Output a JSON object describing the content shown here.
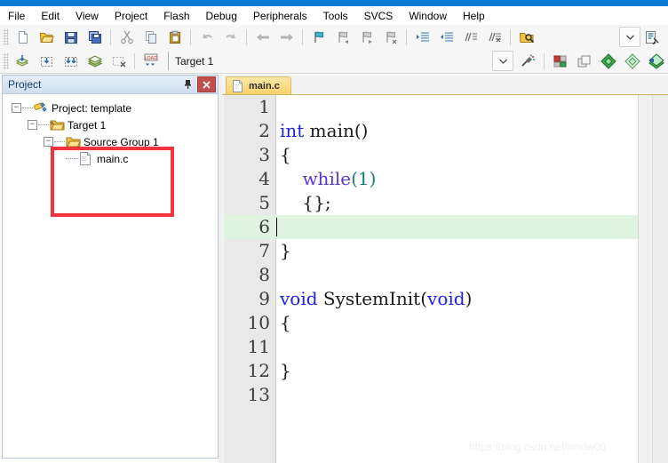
{
  "window": {
    "accent_color": "#0a7bd4"
  },
  "menubar": {
    "items": [
      {
        "label": "File"
      },
      {
        "label": "Edit"
      },
      {
        "label": "View"
      },
      {
        "label": "Project"
      },
      {
        "label": "Flash"
      },
      {
        "label": "Debug"
      },
      {
        "label": "Peripherals"
      },
      {
        "label": "Tools"
      },
      {
        "label": "SVCS"
      },
      {
        "label": "Window"
      },
      {
        "label": "Help"
      }
    ]
  },
  "toolbar1": {
    "icons": [
      "new-file-icon",
      "open-file-icon",
      "save-icon",
      "save-all-icon",
      "cut-icon",
      "copy-icon",
      "paste-icon",
      "undo-icon",
      "redo-icon",
      "navigate-back-icon",
      "navigate-forward-icon",
      "bookmark-toggle-icon",
      "bookmark-prev-icon",
      "bookmark-next-icon",
      "bookmark-clear-icon",
      "indent-icon",
      "outdent-icon",
      "comment-icon",
      "uncomment-icon",
      "find-in-files-icon"
    ],
    "right_icons": [
      "combo-arrow-icon",
      "configure-icon"
    ]
  },
  "toolbar2": {
    "icons": [
      "translate-icon",
      "build-icon",
      "rebuild-icon",
      "batch-build-icon",
      "stop-build-icon",
      "download-icon"
    ],
    "target_value": "Target 1",
    "target_placeholder": "Target 1",
    "right_icons": [
      "combo-arrow-icon",
      "target-options-icon"
    ],
    "trailing_icons": [
      "manage-components-icon",
      "pack-installer-icon",
      "manage-runtime-icon",
      "pack-manager-icon"
    ]
  },
  "project_panel": {
    "title": "Project",
    "pin_icon": "pin-icon",
    "close_icon": "close-icon",
    "tree": [
      {
        "label": "Project: template",
        "icon": "project-icon",
        "depth": 0,
        "expander": "-"
      },
      {
        "label": "Target 1",
        "icon": "target-folder-icon",
        "depth": 1,
        "expander": "-"
      },
      {
        "label": "Source Group 1",
        "icon": "folder-icon",
        "depth": 2,
        "expander": "-"
      },
      {
        "label": "main.c",
        "icon": "c-file-icon",
        "depth": 3,
        "expander": ""
      }
    ],
    "annotation": {
      "shape": "rectangle",
      "color": "#f5333f"
    }
  },
  "editor": {
    "tabs": [
      {
        "label": "main.c",
        "icon": "c-file-icon",
        "active": true
      }
    ],
    "current_line": 6,
    "lines": [
      {
        "n": "1",
        "segments": []
      },
      {
        "n": "2",
        "segments": [
          {
            "t": "int",
            "c": "kw"
          },
          {
            "t": " main",
            "c": ""
          },
          {
            "t": "()",
            "c": ""
          }
        ]
      },
      {
        "n": "3",
        "segments": [
          {
            "t": "{",
            "c": ""
          }
        ]
      },
      {
        "n": "4",
        "segments": [
          {
            "t": "    ",
            "c": ""
          },
          {
            "t": "while",
            "c": "kw2"
          },
          {
            "t": "(",
            "c": "par"
          },
          {
            "t": "1",
            "c": "num"
          },
          {
            "t": ")",
            "c": "par"
          }
        ]
      },
      {
        "n": "5",
        "segments": [
          {
            "t": "    {};",
            "c": ""
          }
        ]
      },
      {
        "n": "6",
        "segments": []
      },
      {
        "n": "7",
        "segments": [
          {
            "t": "}",
            "c": ""
          }
        ]
      },
      {
        "n": "8",
        "segments": []
      },
      {
        "n": "9",
        "segments": [
          {
            "t": "void",
            "c": "kw"
          },
          {
            "t": " SystemInit",
            "c": ""
          },
          {
            "t": "(",
            "c": ""
          },
          {
            "t": "void",
            "c": "kw"
          },
          {
            "t": ")",
            "c": ""
          }
        ]
      },
      {
        "n": "10",
        "segments": [
          {
            "t": "{",
            "c": ""
          }
        ]
      },
      {
        "n": "11",
        "segments": []
      },
      {
        "n": "12",
        "segments": [
          {
            "t": "}",
            "c": ""
          }
        ]
      },
      {
        "n": "13",
        "segments": []
      }
    ]
  },
  "watermark": {
    "text": "https://blog.csdn.net/imxlw00"
  }
}
